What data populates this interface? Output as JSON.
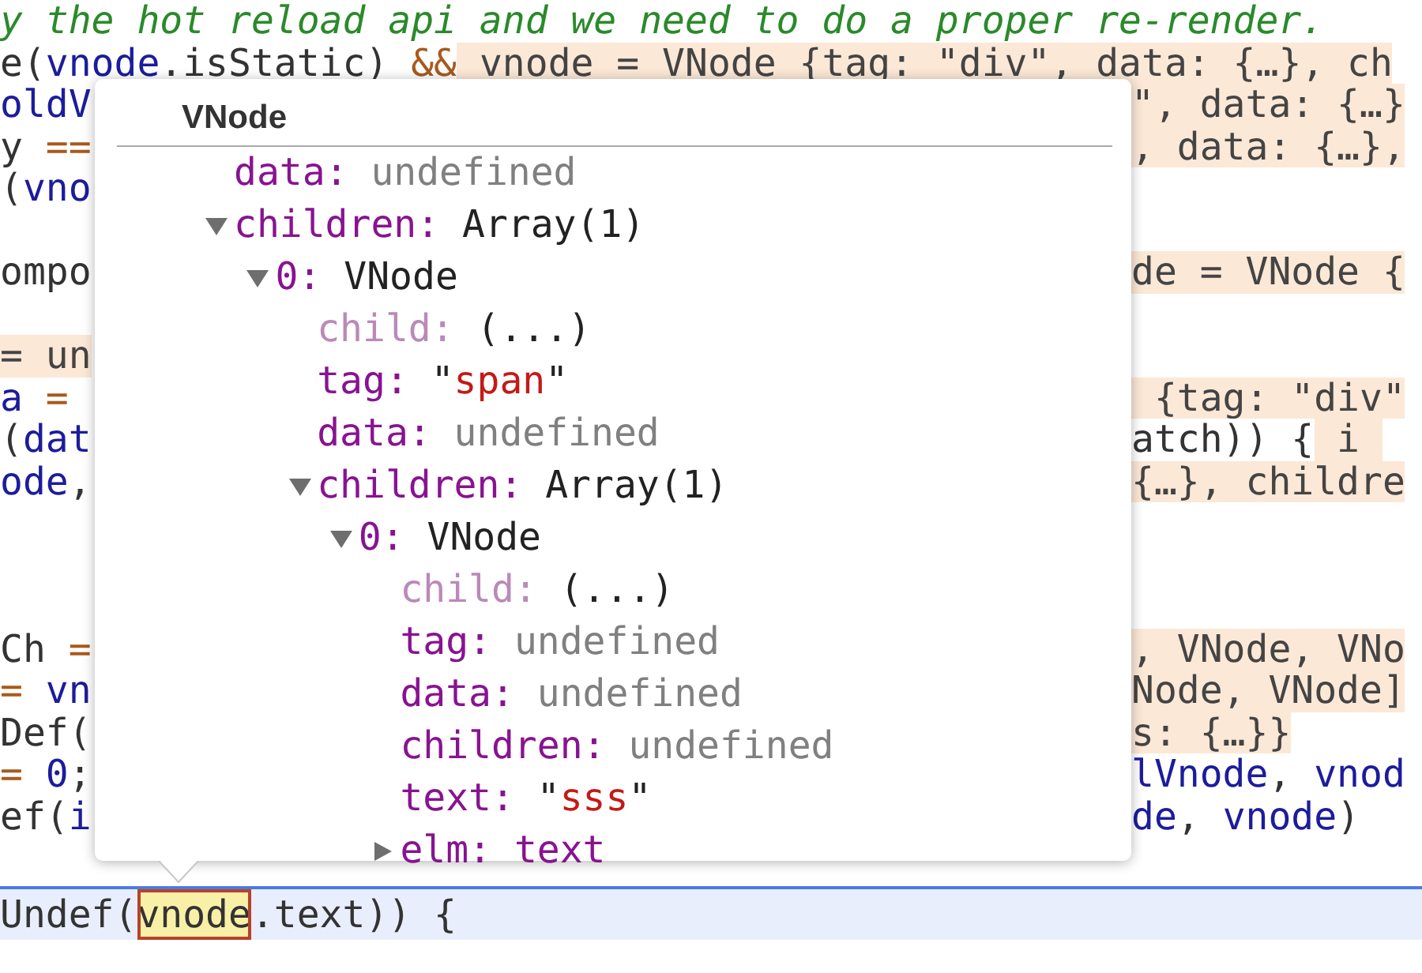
{
  "code_lines": [
    {
      "kind": "full",
      "left": [
        {
          "text": "y the hot reload api and we need to do a proper re-render.",
          "kind": "comment"
        }
      ]
    },
    {
      "kind": "full",
      "left": [
        {
          "text": "e(",
          "kind": "plain"
        },
        {
          "text": "vnode",
          "kind": "ident"
        },
        {
          "text": ".isStatic) ",
          "kind": "plain"
        },
        {
          "text": "&&",
          "kind": "operator"
        },
        {
          "text": " vnode = VNode {tag: \"div\", data: {…}, ch",
          "kind": "value"
        }
      ]
    },
    {
      "kind": "split",
      "left": [
        {
          "text": "oldV",
          "kind": "ident"
        }
      ],
      "right": [
        {
          "text": "\", data: {…}",
          "kind": "value"
        }
      ]
    },
    {
      "kind": "split",
      "left": [
        {
          "text": "y ",
          "kind": "plain"
        },
        {
          "text": "==",
          "kind": "operator"
        }
      ],
      "right": [
        {
          "text": ", data: {…},",
          "kind": "value"
        }
      ]
    },
    {
      "kind": "split",
      "left": [
        {
          "text": "(",
          "kind": "plain"
        },
        {
          "text": "vno",
          "kind": "ident"
        }
      ]
    },
    {
      "kind": "blank"
    },
    {
      "kind": "split",
      "left": [
        {
          "text": "ompo",
          "kind": "plain"
        }
      ],
      "right": [
        {
          "text": "de = VNode {",
          "kind": "value"
        }
      ]
    },
    {
      "kind": "blank"
    },
    {
      "kind": "split",
      "left": [
        {
          "text": "= un",
          "kind": "value"
        }
      ]
    },
    {
      "kind": "split",
      "left": [
        {
          "text": "a ",
          "kind": "ident"
        },
        {
          "text": "=",
          "kind": "operator"
        }
      ],
      "right": [
        {
          "text": " {tag: \"div\"",
          "kind": "value"
        }
      ]
    },
    {
      "kind": "split",
      "left": [
        {
          "text": "(",
          "kind": "plain"
        },
        {
          "text": "dat",
          "kind": "ident"
        }
      ],
      "right": [
        {
          "text": "atch)) {",
          "kind": "plain"
        },
        {
          "text": " i ",
          "kind": "value"
        }
      ]
    },
    {
      "kind": "split",
      "left": [
        {
          "text": "ode",
          "kind": "ident"
        },
        {
          "text": ",",
          "kind": "plain"
        }
      ],
      "right": [
        {
          "text": "{…}, childre",
          "kind": "value"
        }
      ]
    },
    {
      "kind": "blank"
    },
    {
      "kind": "blank"
    },
    {
      "kind": "blank"
    },
    {
      "kind": "split",
      "left": [
        {
          "text": "Ch ",
          "kind": "plain"
        },
        {
          "text": "=",
          "kind": "operator"
        }
      ],
      "right": [
        {
          "text": ", VNode, VNo",
          "kind": "value"
        }
      ]
    },
    {
      "kind": "split",
      "left": [
        {
          "text": "=",
          "kind": "operator"
        },
        {
          "text": " vn",
          "kind": "ident"
        }
      ],
      "right": [
        {
          "text": "Node, VNode]",
          "kind": "value"
        }
      ]
    },
    {
      "kind": "split",
      "left": [
        {
          "text": "Def(",
          "kind": "plain"
        }
      ],
      "right": [
        {
          "text": "s: {…}}",
          "kind": "value"
        }
      ]
    },
    {
      "kind": "split",
      "left": [
        {
          "text": "=",
          "kind": "operator"
        },
        {
          "text": " 0",
          "kind": "ident"
        },
        {
          "text": ";",
          "kind": "plain"
        }
      ],
      "right": [
        {
          "text": "lVnode",
          "kind": "ident"
        },
        {
          "text": ", ",
          "kind": "plain"
        },
        {
          "text": "vnod",
          "kind": "ident"
        }
      ]
    },
    {
      "kind": "split",
      "left": [
        {
          "text": "ef(",
          "kind": "plain"
        },
        {
          "text": "i",
          "kind": "ident"
        }
      ],
      "right": [
        {
          "text": "de",
          "kind": "ident"
        },
        {
          "text": ", ",
          "kind": "plain"
        },
        {
          "text": "vnode",
          "kind": "ident"
        },
        {
          "text": ")",
          "kind": "plain"
        }
      ]
    },
    {
      "kind": "blank"
    },
    {
      "kind": "current",
      "left": [
        {
          "text": "Undef(",
          "kind": "plain"
        },
        {
          "text": "vnode",
          "kind": "match"
        },
        {
          "text": ".text)) {",
          "kind": "plain"
        }
      ]
    }
  ],
  "popover": {
    "title": "VNode",
    "tree": [
      {
        "key": "data:",
        "value": "undefined",
        "kind": "undefined"
      },
      {
        "key": "children:",
        "value": "Array(1)",
        "kind": "object",
        "expanded": true,
        "children": [
          {
            "key": "0:",
            "value": "VNode",
            "kind": "object",
            "expanded": true,
            "children": [
              {
                "key": "child:",
                "value": "(...)",
                "kind": "getter"
              },
              {
                "key": "tag:",
                "value": "\"span\"",
                "kind": "string"
              },
              {
                "key": "data:",
                "value": "undefined",
                "kind": "undefined"
              },
              {
                "key": "children:",
                "value": "Array(1)",
                "kind": "object",
                "expanded": true,
                "children": [
                  {
                    "key": "0:",
                    "value": "VNode",
                    "kind": "object",
                    "expanded": true,
                    "children": [
                      {
                        "key": "child:",
                        "value": "(...)",
                        "kind": "getter"
                      },
                      {
                        "key": "tag:",
                        "value": "undefined",
                        "kind": "undefined"
                      },
                      {
                        "key": "data:",
                        "value": "undefined",
                        "kind": "undefined"
                      },
                      {
                        "key": "children:",
                        "value": "undefined",
                        "kind": "undefined"
                      },
                      {
                        "key": "text:",
                        "value": "\"sss\"",
                        "kind": "string"
                      },
                      {
                        "key": "elm:",
                        "value": "text",
                        "kind": "node",
                        "expanded": false
                      }
                    ]
                  }
                ]
              }
            ]
          }
        ]
      }
    ]
  }
}
